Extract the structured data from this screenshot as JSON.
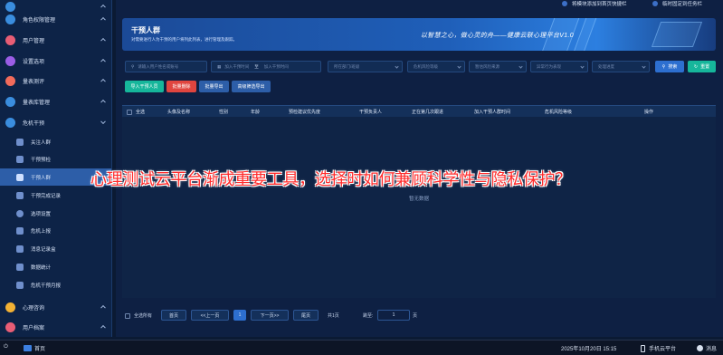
{
  "colors": {
    "accent": "#2d5ea8",
    "reset": "#16b69b",
    "danger": "#e0453f",
    "headline": "#ff2c2c"
  },
  "sidebar": {
    "items": [
      {
        "label": "",
        "icon": "grid-icon",
        "color": "#3a8dde"
      },
      {
        "label": "角色权限管理",
        "icon": "role-icon",
        "color": "#3a8dde"
      },
      {
        "label": "用户管理",
        "icon": "user-icon",
        "color": "#e85d75"
      },
      {
        "label": "设置选项",
        "icon": "settings-icon",
        "color": "#9b5de5"
      },
      {
        "label": "量表测评",
        "icon": "heart-icon",
        "color": "#f26b5b"
      },
      {
        "label": "量表库管理",
        "icon": "library-icon",
        "color": "#3a8dde"
      },
      {
        "label": "危机干预",
        "icon": "alert-icon",
        "color": "#3a8dde"
      }
    ],
    "subitems": [
      {
        "label": "关注人群",
        "icon": "people-icon"
      },
      {
        "label": "干预预检",
        "icon": "check-icon"
      },
      {
        "label": "干预人群",
        "icon": "target-icon"
      },
      {
        "label": "干预完成记录",
        "icon": "record-icon"
      },
      {
        "label": "选项设置",
        "icon": "gear-icon"
      },
      {
        "label": "危机上报",
        "icon": "report-icon"
      },
      {
        "label": "消息记录盒",
        "icon": "inbox-icon"
      },
      {
        "label": "数据统计",
        "icon": "stats-icon"
      },
      {
        "label": "危机干预月报",
        "icon": "monthly-icon"
      }
    ],
    "bottom": [
      {
        "label": "心理咨询",
        "icon": "consult-icon",
        "color": "#f2b134"
      },
      {
        "label": "用户档案",
        "icon": "file-icon",
        "color": "#e85d75"
      }
    ]
  },
  "topbar": {
    "link1": "将模块添加到首页快捷栏",
    "link2": "临时固定到任务栏"
  },
  "banner": {
    "title": "干预人群",
    "desc": "对需要进行人为干预的用户将列此列表，进行管理及跟踪。",
    "slogan": "以智慧之心，做心灵的舟——健康云联心理平台V1.0"
  },
  "filters": {
    "name_placeholder": "请输入用户姓名或账号",
    "date_start": "加入干预时间",
    "date_sep": "至",
    "date_end": "加入干预时间",
    "dept": "所在部门/班级",
    "risk": "危机风险等级",
    "source": "暂估风险来源",
    "behavior": "异常行为表现",
    "status": "处理进度",
    "search": "搜索",
    "reset": "重置"
  },
  "actions": {
    "add": "导入干预人员",
    "batch_delete": "批量删除",
    "batch_export": "批量导出",
    "advanced_export": "高级筛选导出"
  },
  "table": {
    "select_all": "全选",
    "columns": [
      "头像及名称",
      "性别",
      "年龄",
      "预检建议优先度",
      "干预负责人",
      "正在第几次跟进",
      "加入干预人群时间",
      "危机风险等级",
      "操作"
    ],
    "empty_text": "暂无数据"
  },
  "pagination": {
    "select_all": "全选所有",
    "first": "首页",
    "prev": "<<上一页",
    "current": "1",
    "next": "下一页>>",
    "last": "尾页",
    "total": "共1页",
    "jump_label": "跳至:",
    "jump_value": "1",
    "page_unit": "页"
  },
  "overlay": {
    "headline": "心理测试云平台渐成重要工具，选择时如何兼顾科学性与隐私保护？"
  },
  "taskbar": {
    "start": "首页",
    "datetime": "2025年10月20日 15:15",
    "mobile": "手机云平台",
    "messages": "消息"
  }
}
